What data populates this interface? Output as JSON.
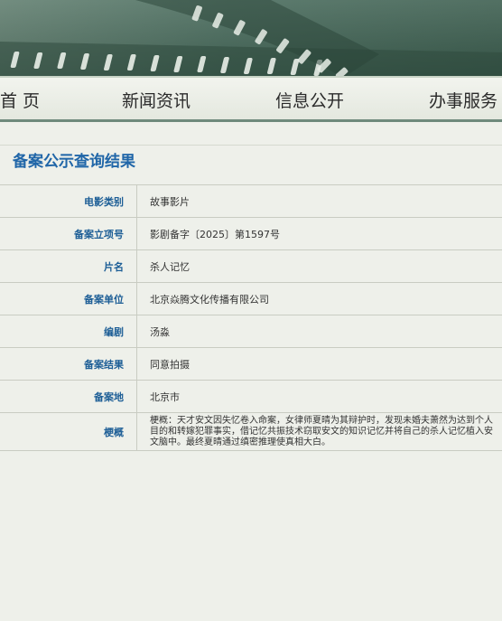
{
  "nav": {
    "items": [
      "首 页",
      "新闻资讯",
      "信息公开",
      "办事服务"
    ]
  },
  "section_title": "备案公示查询结果",
  "rows": [
    {
      "label": "电影类别",
      "value": "故事影片"
    },
    {
      "label": "备案立项号",
      "value": "影剧备字〔2025〕第1597号"
    },
    {
      "label": "片名",
      "value": "杀人记忆"
    },
    {
      "label": "备案单位",
      "value": "北京焱腾文化传播有限公司"
    },
    {
      "label": "编剧",
      "value": "汤淼"
    },
    {
      "label": "备案结果",
      "value": "同意拍摄"
    },
    {
      "label": "备案地",
      "value": "北京市"
    },
    {
      "label": "梗概",
      "value": "梗概：天才安文因失忆卷入命案，女律师夏晴为其辩护时，发现未婚夫萧然为达到个人目的和转嫁犯罪事实，借记忆共振技术窃取安文的知识记忆并将自己的杀人记忆植入安文脑中。最终夏晴通过缜密推理使真相大白。"
    }
  ],
  "colors": {
    "title": "#2066a8",
    "label": "#1d5e96",
    "banner": "#46695a"
  }
}
